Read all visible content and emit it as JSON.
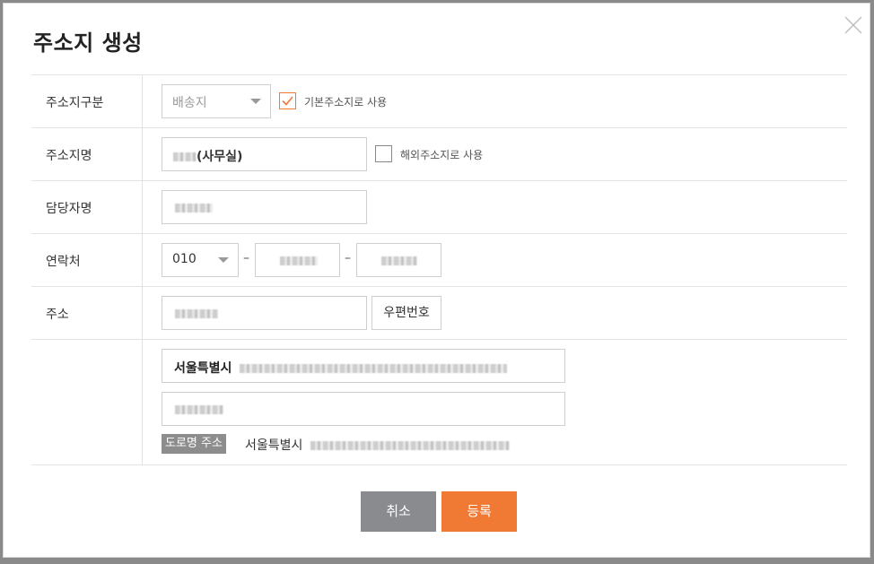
{
  "dialog": {
    "title": "주소지 생성",
    "close_icon": "close-icon"
  },
  "form": {
    "type_label": "주소지구분",
    "type_select": {
      "value": "배송지"
    },
    "default_checkbox": {
      "label": "기본주소지로 사용",
      "checked": true
    },
    "name_label": "주소지명",
    "name_value_suffix": "(사무실)",
    "overseas_checkbox": {
      "label": "해외주소지로 사용",
      "checked": false
    },
    "manager_label": "담당자명",
    "contact_label": "연락처",
    "contact_prefix": {
      "value": "010"
    },
    "contact_dash": "–",
    "address_label": "주소",
    "postal_button": "우편번호",
    "address_line1_prefix": "서울특별시",
    "road_badge": "도로명 주소",
    "road_prefix": "서울특별시"
  },
  "buttons": {
    "cancel": "취소",
    "submit": "등록"
  },
  "colors": {
    "accent": "#f07a34",
    "cancel": "#8a8b8f",
    "border": "#cfcfcf"
  }
}
